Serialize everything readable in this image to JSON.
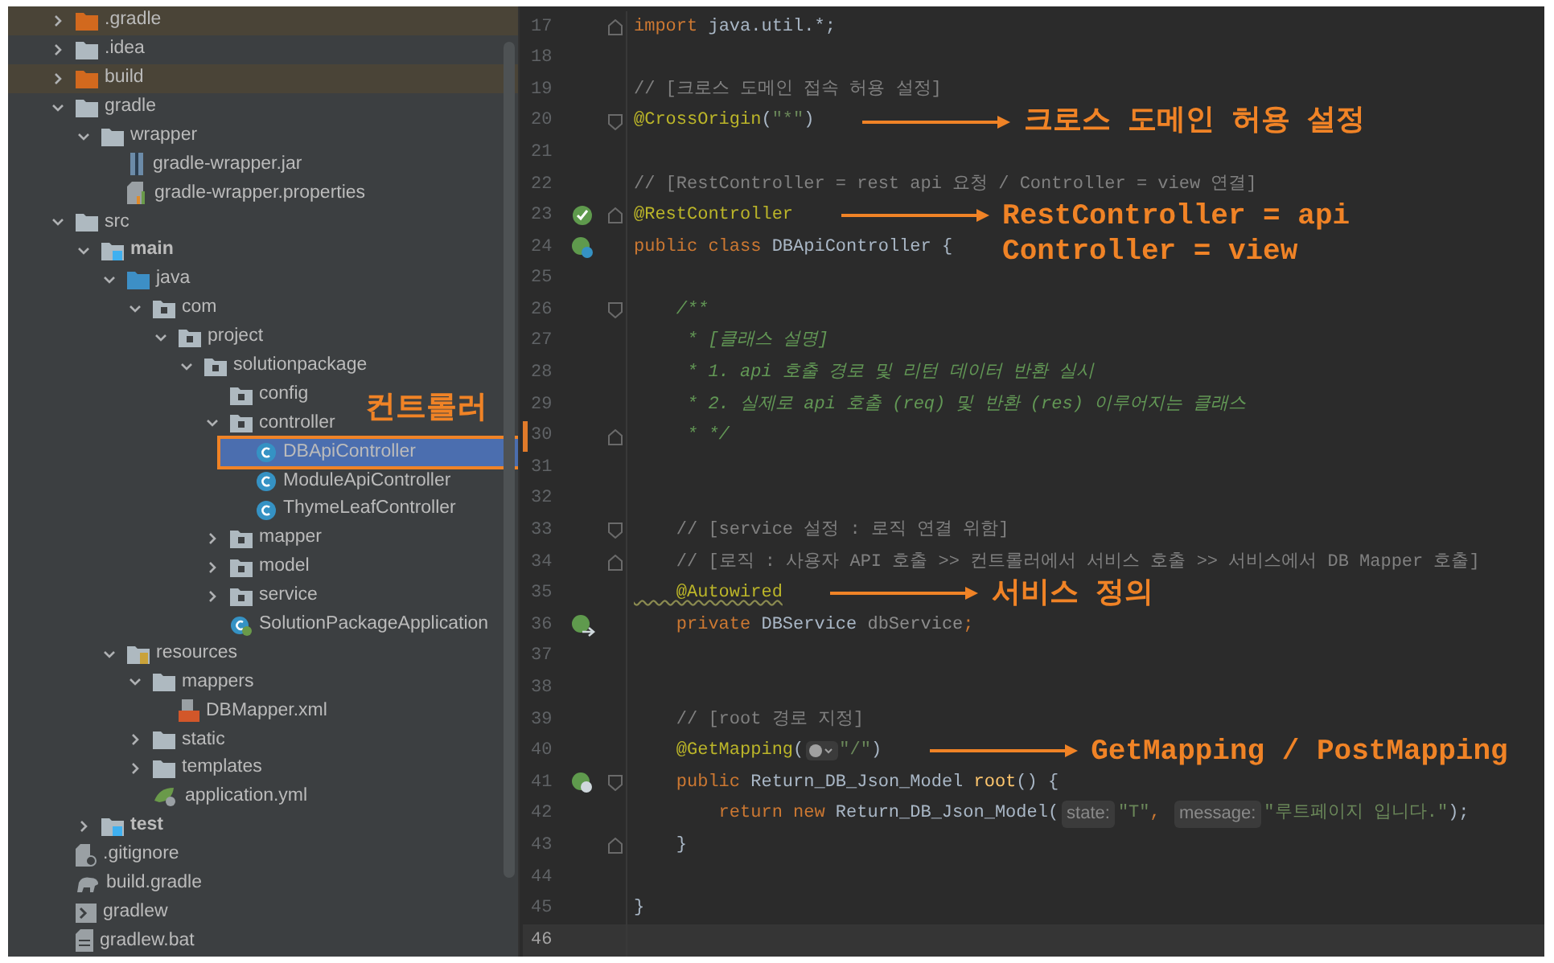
{
  "project_tree": {
    "items": [
      {
        "name": ".gradle",
        "kind": "excluded-folder",
        "expanded": false,
        "selected": false
      },
      {
        "name": ".idea",
        "kind": "folder",
        "expanded": false,
        "selected": false
      },
      {
        "name": "build",
        "kind": "excluded-folder",
        "expanded": false,
        "selected": false
      },
      {
        "name": "gradle",
        "kind": "folder",
        "expanded": true,
        "selected": false,
        "children": [
          {
            "name": "wrapper",
            "kind": "folder",
            "expanded": true,
            "selected": false,
            "children": [
              {
                "name": "gradle-wrapper.jar",
                "kind": "jar",
                "selected": false
              },
              {
                "name": "gradle-wrapper.properties",
                "kind": "properties",
                "selected": false
              }
            ]
          }
        ]
      },
      {
        "name": "src",
        "kind": "folder",
        "expanded": true,
        "selected": false,
        "children": [
          {
            "name": "main",
            "kind": "module-folder",
            "expanded": true,
            "selected": false,
            "children": [
              {
                "name": "java",
                "kind": "source-folder",
                "expanded": true,
                "selected": false,
                "children": [
                  {
                    "name": "com",
                    "kind": "package",
                    "expanded": true,
                    "selected": false,
                    "children": [
                      {
                        "name": "project",
                        "kind": "package",
                        "expanded": true,
                        "selected": false,
                        "children": [
                          {
                            "name": "solutionpackage",
                            "kind": "package",
                            "expanded": true,
                            "selected": false,
                            "children": [
                              {
                                "name": "config",
                                "kind": "package",
                                "selected": false
                              },
                              {
                                "name": "controller",
                                "kind": "package",
                                "expanded": true,
                                "selected": false,
                                "callout": "컨트롤러",
                                "children": [
                                  {
                                    "name": "DBApiController",
                                    "kind": "class",
                                    "selected": true,
                                    "outlined": true
                                  },
                                  {
                                    "name": "ModuleApiController",
                                    "kind": "class",
                                    "selected": false,
                                    "outlined": false
                                  },
                                  {
                                    "name": "ThymeLeafController",
                                    "kind": "class",
                                    "selected": false,
                                    "outlined": false
                                  }
                                ]
                              },
                              {
                                "name": "mapper",
                                "kind": "package",
                                "expanded": false,
                                "selected": false
                              },
                              {
                                "name": "model",
                                "kind": "package",
                                "expanded": false,
                                "selected": false
                              },
                              {
                                "name": "service",
                                "kind": "package",
                                "expanded": false,
                                "selected": false
                              },
                              {
                                "name": "SolutionPackageApplication",
                                "kind": "spring-class",
                                "selected": false
                              }
                            ]
                          }
                        ]
                      }
                    ]
                  }
                ]
              },
              {
                "name": "resources",
                "kind": "resources-folder",
                "expanded": true,
                "selected": false,
                "children": [
                  {
                    "name": "mappers",
                    "kind": "folder",
                    "expanded": true,
                    "selected": false,
                    "children": [
                      {
                        "name": "DBMapper.xml",
                        "kind": "xml",
                        "selected": false
                      }
                    ]
                  },
                  {
                    "name": "static",
                    "kind": "folder",
                    "expanded": false,
                    "selected": false
                  },
                  {
                    "name": "templates",
                    "kind": "folder",
                    "expanded": false,
                    "selected": false
                  },
                  {
                    "name": "application.yml",
                    "kind": "yml",
                    "selected": false
                  }
                ]
              }
            ]
          },
          {
            "name": "test",
            "kind": "module-folder",
            "expanded": false,
            "selected": false
          }
        ]
      },
      {
        "name": ".gitignore",
        "kind": "gitignore",
        "selected": false
      },
      {
        "name": "build.gradle",
        "kind": "gradle",
        "selected": false
      },
      {
        "name": "gradlew",
        "kind": "shell",
        "selected": false
      },
      {
        "name": "gradlew.bat",
        "kind": "bat",
        "selected": false
      }
    ]
  },
  "editor": {
    "lines": [
      {
        "number": "17",
        "current": false,
        "changed": false,
        "fold": {
          "kind": "close"
        },
        "tokens": [
          {
            "kind": "keyword",
            "text": "import "
          },
          {
            "kind": "plain",
            "text": "java.util.*;"
          }
        ]
      },
      {
        "number": "18",
        "current": false,
        "changed": false
      },
      {
        "number": "19",
        "current": false,
        "changed": false,
        "tokens": [
          {
            "kind": "comment",
            "text": "// [크로스 도메인 접속 허용 설정]"
          }
        ]
      },
      {
        "number": "20",
        "current": false,
        "changed": false,
        "fold": {
          "kind": "open"
        },
        "tokens": [
          {
            "kind": "annotation",
            "text": "@CrossOrigin"
          },
          {
            "kind": "plain",
            "text": "("
          },
          {
            "kind": "string",
            "text": "\"*\""
          },
          {
            "kind": "plain",
            "text": ")"
          }
        ],
        "callout": {
          "lines": [
            "크로스 도메인 허용 설정"
          ],
          "arrow": true
        }
      },
      {
        "number": "21",
        "current": false,
        "changed": false
      },
      {
        "number": "22",
        "current": false,
        "changed": false,
        "tokens": [
          {
            "kind": "comment",
            "text": "// [RestController = rest api 요청 / Controller = view 연결]"
          }
        ]
      },
      {
        "number": "23",
        "current": false,
        "changed": false,
        "fold": {
          "kind": "close"
        },
        "gutter": {
          "kind": "bean-check"
        },
        "tokens": [
          {
            "kind": "annotation",
            "text": "@RestController"
          }
        ],
        "callout": {
          "lines": [
            "RestController = api",
            "Controller = view"
          ],
          "arrow": true
        }
      },
      {
        "number": "24",
        "current": false,
        "changed": false,
        "gutter": {
          "kind": "bean-web"
        },
        "tokens": [
          {
            "kind": "keyword",
            "text": "public class "
          },
          {
            "kind": "plain",
            "text": "DBApiController {"
          }
        ]
      },
      {
        "number": "25",
        "current": false,
        "changed": false
      },
      {
        "number": "26",
        "current": false,
        "changed": false,
        "fold": {
          "kind": "open"
        },
        "tokens": [
          {
            "kind": "doc",
            "text": "    /**"
          }
        ]
      },
      {
        "number": "27",
        "current": false,
        "changed": false,
        "tokens": [
          {
            "kind": "doc",
            "text": "     * [클래스 설명]"
          }
        ]
      },
      {
        "number": "28",
        "current": false,
        "changed": false,
        "tokens": [
          {
            "kind": "doc",
            "text": "     * 1. api 호출 경로 및 리턴 데이터 반환 실시"
          }
        ]
      },
      {
        "number": "29",
        "current": false,
        "changed": false,
        "tokens": [
          {
            "kind": "doc",
            "text": "     * 2. 실제로 api 호출 (req) 및 반환 (res) 이루어지는 클래스"
          }
        ]
      },
      {
        "number": "30",
        "current": false,
        "changed": true,
        "fold": {
          "kind": "close"
        },
        "tokens": [
          {
            "kind": "doc",
            "text": "     * */"
          }
        ]
      },
      {
        "number": "31",
        "current": false,
        "changed": false
      },
      {
        "number": "32",
        "current": false,
        "changed": false
      },
      {
        "number": "33",
        "current": false,
        "changed": false,
        "fold": {
          "kind": "open"
        },
        "tokens": [
          {
            "kind": "comment",
            "text": "    // [service 설정 : 로직 연결 위함]"
          }
        ]
      },
      {
        "number": "34",
        "current": false,
        "changed": false,
        "fold": {
          "kind": "close"
        },
        "tokens": [
          {
            "kind": "comment",
            "text": "    // [로직 : 사용자 API 호출 >> 컨트롤러에서 서비스 호출 >> 서비스에서 DB Mapper 호출]"
          }
        ]
      },
      {
        "number": "35",
        "current": false,
        "changed": false,
        "tokens": [
          {
            "kind": "annotation-warn",
            "text": "    @Autowired"
          }
        ],
        "callout": {
          "lines": [
            "서비스 정의"
          ],
          "arrow": true
        }
      },
      {
        "number": "36",
        "current": false,
        "changed": false,
        "gutter": {
          "kind": "autowire"
        },
        "tokens": [
          {
            "kind": "keyword",
            "text": "    private "
          },
          {
            "kind": "plain",
            "text": "DBService "
          },
          {
            "kind": "unused",
            "text": "dbService"
          },
          {
            "kind": "keyword",
            "text": ";"
          }
        ]
      },
      {
        "number": "37",
        "current": false,
        "changed": false
      },
      {
        "number": "38",
        "current": false,
        "changed": false
      },
      {
        "number": "39",
        "current": false,
        "changed": false,
        "tokens": [
          {
            "kind": "comment",
            "text": "    // [root 경로 지정]"
          }
        ]
      },
      {
        "number": "40",
        "current": false,
        "changed": false,
        "tokens": [
          {
            "kind": "annotation",
            "text": "    @GetMapping"
          },
          {
            "kind": "plain",
            "text": "("
          },
          {
            "kind": "url-icon"
          },
          {
            "kind": "string",
            "text": "\"/\""
          },
          {
            "kind": "plain",
            "text": ")"
          }
        ],
        "callout": {
          "lines": [
            "GetMapping / PostMapping"
          ],
          "arrow": true
        }
      },
      {
        "number": "41",
        "current": false,
        "changed": false,
        "fold": {
          "kind": "open"
        },
        "gutter": {
          "kind": "web"
        },
        "tokens": [
          {
            "kind": "keyword",
            "text": "    public "
          },
          {
            "kind": "plain",
            "text": "Return_DB_Json_Model "
          },
          {
            "kind": "method",
            "text": "root"
          },
          {
            "kind": "plain",
            "text": "() {"
          }
        ]
      },
      {
        "number": "42",
        "current": false,
        "changed": false,
        "tokens": [
          {
            "kind": "keyword",
            "text": "        return new "
          },
          {
            "kind": "plain",
            "text": "Return_DB_Json_Model("
          },
          {
            "kind": "hint",
            "text": "state:"
          },
          {
            "kind": "string",
            "text": "\"T\""
          },
          {
            "kind": "keyword",
            "text": ", "
          },
          {
            "kind": "hint",
            "text": "message:"
          },
          {
            "kind": "string",
            "text": "\"루트페이지 입니다.\""
          },
          {
            "kind": "plain",
            "text": ");"
          }
        ]
      },
      {
        "number": "43",
        "current": false,
        "changed": false,
        "fold": {
          "kind": "close"
        },
        "tokens": [
          {
            "kind": "plain",
            "text": "    }"
          }
        ]
      },
      {
        "number": "44",
        "current": false,
        "changed": false
      },
      {
        "number": "45",
        "current": false,
        "changed": false,
        "tokens": [
          {
            "kind": "plain",
            "text": "}"
          }
        ]
      },
      {
        "number": "46",
        "current": true,
        "changed": false
      }
    ]
  }
}
